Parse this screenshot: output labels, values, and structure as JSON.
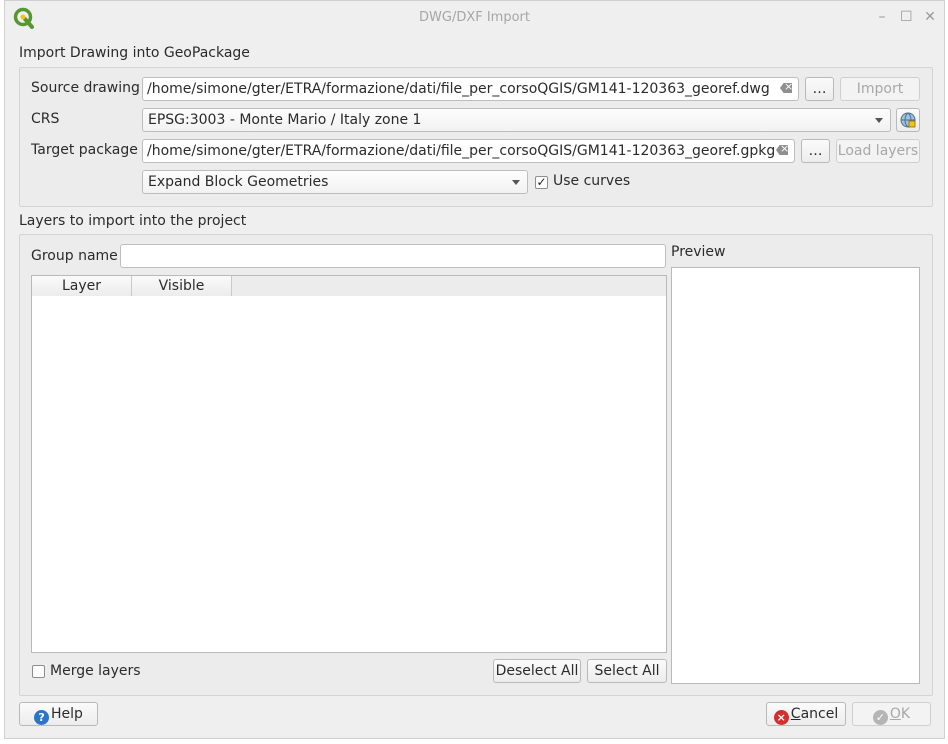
{
  "window": {
    "title": "DWG/DXF Import",
    "minimize": "–",
    "maximize": "☐",
    "close": "✕"
  },
  "import_section": {
    "title": "Import Drawing into GeoPackage",
    "source_label": "Source drawing",
    "source_value": "/home/simone/gter/ETRA/formazione/dati/file_per_corsoQGIS/GM141-120363_georef.dwg",
    "browse_label": "…",
    "import_label": "Import",
    "crs_label": "CRS",
    "crs_value": "EPSG:3003 - Monte Mario / Italy zone 1",
    "target_label": "Target package",
    "target_value": "/home/simone/gter/ETRA/formazione/dati/file_per_corsoQGIS/GM141-120363_georef.gpkg",
    "load_layers_label": "Load layers",
    "block_mode_value": "Expand Block Geometries",
    "use_curves_label": "Use curves",
    "use_curves_checked": "✓"
  },
  "layers_section": {
    "title": "Layers to import into the project",
    "group_name_label": "Group name",
    "group_name_value": "",
    "columns": [
      "Layer",
      "Visible"
    ],
    "preview_label": "Preview",
    "merge_layers_label": "Merge layers",
    "deselect_all_label": "Deselect All",
    "select_all_label": "Select All"
  },
  "footer": {
    "help_label": "Help",
    "cancel_prefix": "C",
    "cancel_rest": "ancel",
    "ok_prefix": "O",
    "ok_rest": "K"
  },
  "icons": {
    "qgis_logo": "qgis-logo-icon",
    "crs_selector": "globe-icon",
    "help": "help-icon",
    "cancel": "cancel-icon",
    "ok": "ok-icon"
  },
  "colors": {
    "qgis_green": "#589632",
    "qgis_yellow": "#f0c419",
    "help_blue": "#2a75c9",
    "cancel_red": "#d32f2f",
    "ok_disabled": "#b5b5b5"
  }
}
